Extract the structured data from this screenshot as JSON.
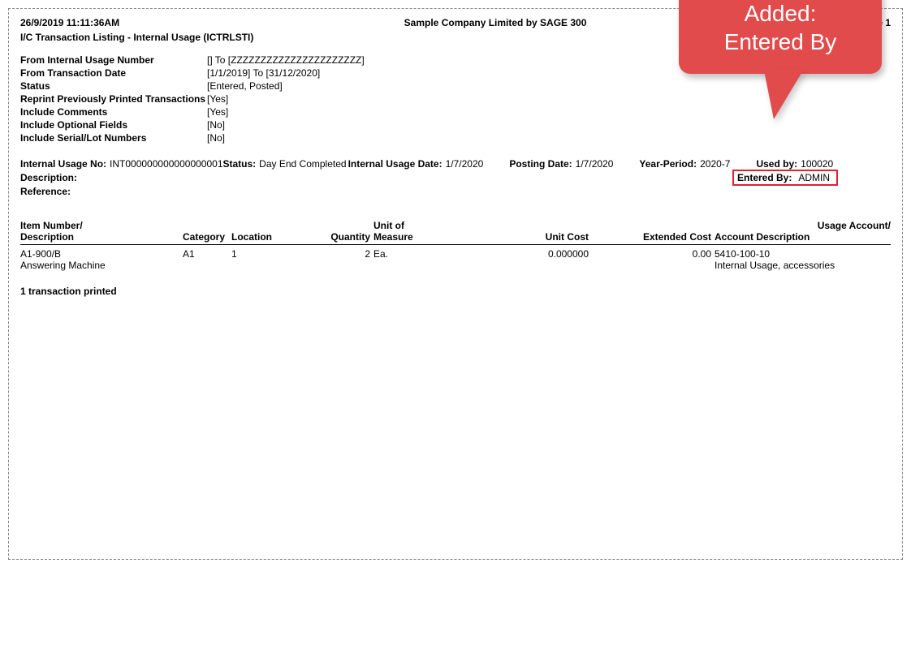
{
  "header": {
    "datetime": "26/9/2019 11:11:36AM",
    "company": "Sample Company Limited by SAGE 300",
    "page": "ge 1"
  },
  "report_title": "I/C Transaction Listing - Internal Usage (ICTRLSTI)",
  "params": {
    "from_usage_label": "From Internal Usage Number",
    "from_usage_value": "[]  To  [ZZZZZZZZZZZZZZZZZZZZZZ]",
    "from_date_label": "From Transaction Date",
    "from_date_value": "[1/1/2019]  To  [31/12/2020]",
    "status_label": "Status",
    "status_value": "[Entered, Posted]",
    "reprint_label": "Reprint Previously Printed Transactions",
    "reprint_value": "[Yes]",
    "comments_label": "Include Comments",
    "comments_value": "[Yes]",
    "optional_label": "Include Optional Fields",
    "optional_value": "[No]",
    "serial_label": "Include Serial/Lot Numbers",
    "serial_value": "[No]"
  },
  "usage": {
    "no_label": "Internal Usage No:",
    "no_value": "INT000000000000000001",
    "status_label": "Status:",
    "status_value": "Day End Completed",
    "date_label": "Internal Usage Date:",
    "date_value": "1/7/2020",
    "posting_label": "Posting Date:",
    "posting_value": "1/7/2020",
    "yp_label": "Year-Period:",
    "yp_value": "2020-7",
    "usedby_label": "Used by:",
    "usedby_value": "100020",
    "desc_label": "Description:",
    "ref_label": "Reference:",
    "entered_label": "Entered By:",
    "entered_value": "ADMIN"
  },
  "columns": {
    "item1": "Item Number/",
    "item2": "Description",
    "cat": "Category",
    "loc": "Location",
    "qty": "Quantity",
    "uom1": "Unit of",
    "uom2": "Measure",
    "unitcost": "Unit Cost",
    "ext": "Extended Cost",
    "acct1": "Usage Account/",
    "acct2": "Account Description"
  },
  "row": {
    "item": "A1-900/B",
    "desc": "Answering Machine",
    "cat": "A1",
    "loc": "1",
    "qty": "2",
    "uom": "Ea.",
    "unitcost": "0.000000",
    "ext": "0.00",
    "acct": "5410-100-10",
    "acct_desc": "Internal Usage, accessories"
  },
  "footer": "1 transaction printed",
  "callout": {
    "line1": "Added:",
    "line2": "Entered By"
  }
}
